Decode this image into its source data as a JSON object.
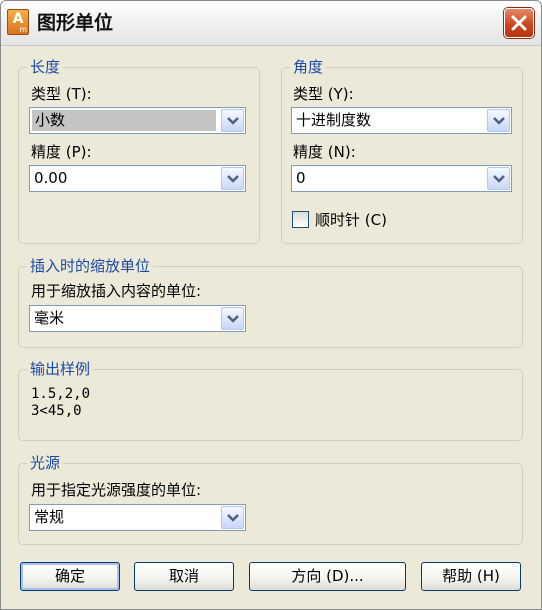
{
  "window": {
    "title": "图形单位"
  },
  "length": {
    "legend": "长度",
    "type_label": "类型 (T):",
    "type_value": "小数",
    "precision_label": "精度 (P):",
    "precision_value": "0.00"
  },
  "angle": {
    "legend": "角度",
    "type_label": "类型 (Y):",
    "type_value": "十进制度数",
    "precision_label": "精度 (N):",
    "precision_value": "0",
    "clockwise_label": "顺时针 (C)",
    "clockwise_checked": false
  },
  "insertion": {
    "legend": "插入时的缩放单位",
    "label": "用于缩放插入内容的单位:",
    "value": "毫米"
  },
  "sample": {
    "legend": "输出样例",
    "line1": "1.5,2,0",
    "line2": "3<45,0"
  },
  "lighting": {
    "legend": "光源",
    "label": "用于指定光源强度的单位:",
    "value": "常规"
  },
  "buttons": {
    "ok": "确定",
    "cancel": "取消",
    "direction": "方向 (D)...",
    "help": "帮助 (H)"
  },
  "icons": {
    "app": "autocad-app-icon",
    "close": "close-icon",
    "dropdown": "chevron-down-icon"
  },
  "colors": {
    "legend_text": "#1c4aa6",
    "dialog_bg": "#ece9d8",
    "close_button": "#c9451f"
  }
}
